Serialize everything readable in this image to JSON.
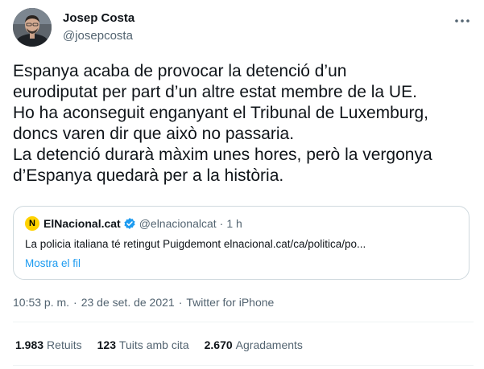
{
  "author": {
    "name": "Josep Costa",
    "handle": "@josepcosta"
  },
  "icons": {
    "more": "more-horizontal-icon",
    "verified": "verified-badge-icon"
  },
  "tweet": {
    "lines": [
      "Espanya acaba de provocar la detenció d’un",
      "eurodiputat per part d’un altre estat membre de la UE.",
      "Ho ha aconseguit enganyant el Tribunal de Luxemburg,",
      "doncs varen dir que això no passaria.",
      "La detenció durarà màxim unes hores, però la vergonya",
      "d’Espanya quedarà per a la història."
    ]
  },
  "quote": {
    "logo_letter": "N",
    "name": "ElNacional.cat",
    "handle": "@elnacionalcat",
    "dot": "·",
    "time": "1 h",
    "text": "La policia italiana té retingut Puigdemont elnacional.cat/ca/politica/po...",
    "show_thread": "Mostra el fil"
  },
  "meta": {
    "time": "10:53 p. m.",
    "sep": "·",
    "date": "23 de set. de 2021",
    "source": "Twitter for iPhone"
  },
  "stats": {
    "retweets_count": "1.983",
    "retweets_label": "Retuits",
    "quotes_count": "123",
    "quotes_label": "Tuits amb cita",
    "likes_count": "2.670",
    "likes_label": "Agradaments"
  },
  "colors": {
    "text": "#0f1419",
    "secondary": "#536471",
    "link": "#1d9bf0",
    "border": "#cfd9de",
    "verified": "#1d9bf0",
    "logo": "#ffd200"
  }
}
